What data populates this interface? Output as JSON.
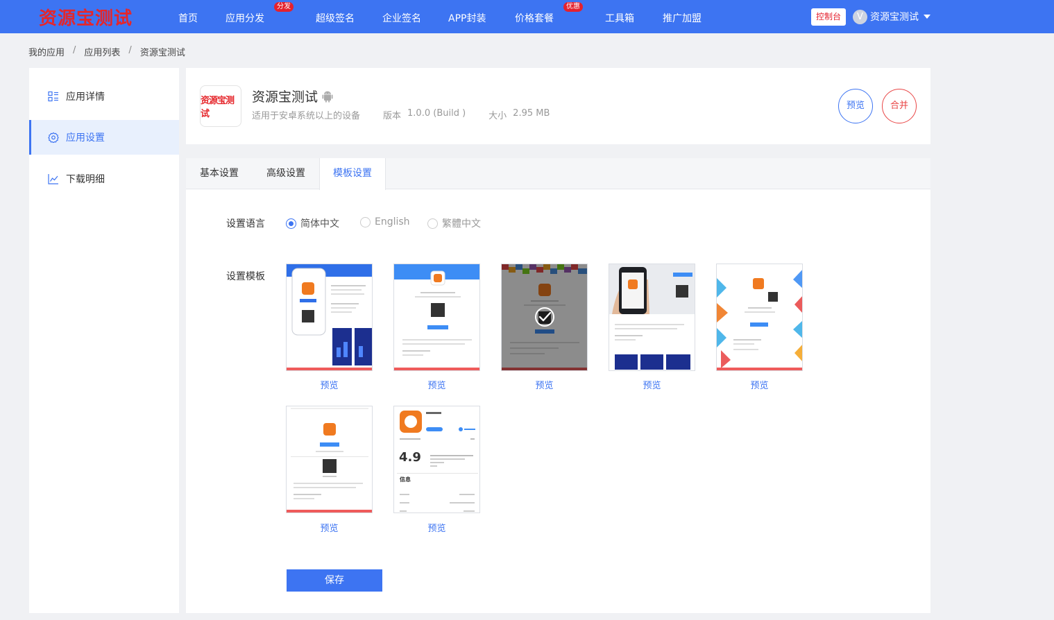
{
  "brand": {
    "logo": "资源宝测试",
    "primary": "#3d74f2",
    "danger": "#e4212e"
  },
  "nav": {
    "items": [
      {
        "label": "首页"
      },
      {
        "label": "应用分发",
        "badge": "分发"
      },
      {
        "label": "超级签名"
      },
      {
        "label": "企业签名"
      },
      {
        "label": "APP封装"
      },
      {
        "label": "价格套餐",
        "badge": "优惠"
      },
      {
        "label": "工具箱"
      },
      {
        "label": "推广加盟"
      }
    ],
    "console": "控制台",
    "user": {
      "avatar_letter": "V",
      "name": "资源宝测试"
    }
  },
  "breadcrumb": [
    "我的应用",
    "应用列表",
    "资源宝测试"
  ],
  "sidebar": {
    "items": [
      {
        "label": "应用详情",
        "icon": "grid-list-icon"
      },
      {
        "label": "应用设置",
        "icon": "gear-icon",
        "active": true
      },
      {
        "label": "下载明细",
        "icon": "line-chart-icon"
      }
    ]
  },
  "app": {
    "icon_text": "资源宝测试",
    "name": "资源宝测试",
    "platform_icon": "android-icon",
    "compat": "适用于安卓系统以上的设备",
    "version_label": "版本",
    "version": "1.0.0 (Build )",
    "size_label": "大小",
    "size": "2.95 MB",
    "preview": "预览",
    "merge": "合并"
  },
  "tabs": [
    {
      "label": "基本设置"
    },
    {
      "label": "高级设置"
    },
    {
      "label": "模板设置",
      "active": true
    }
  ],
  "language": {
    "label": "设置语言",
    "options": [
      {
        "label": "简体中文",
        "checked": true
      },
      {
        "label": "English",
        "checked": false
      },
      {
        "label": "繁體中文",
        "checked": false
      }
    ]
  },
  "templates": {
    "label": "设置模板",
    "preview_label": "预览",
    "selected_index": 2,
    "items": [
      {
        "style": "phone-left-blue"
      },
      {
        "style": "blue-header-center"
      },
      {
        "style": "pixel-top"
      },
      {
        "style": "hand-phone"
      },
      {
        "style": "geometric-sides"
      },
      {
        "style": "plain-center"
      },
      {
        "style": "appstore-rating"
      }
    ],
    "mini_text": {
      "app_name": "海南圈",
      "rating": "4.9",
      "info": "信息"
    }
  },
  "save_label": "保存"
}
